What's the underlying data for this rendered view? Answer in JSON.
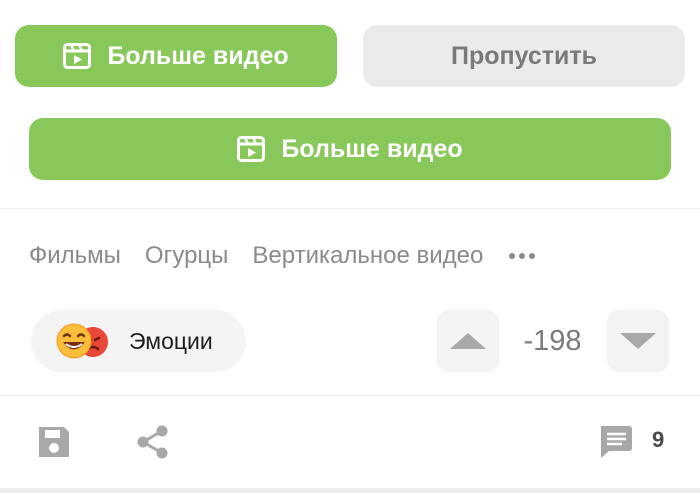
{
  "buttons": {
    "more_video_top": "Больше видео",
    "skip": "Пропустить",
    "more_video_wide": "Больше видео"
  },
  "tags": [
    "Фильмы",
    "Огурцы",
    "Вертикальное видео"
  ],
  "emotions": {
    "label": "Эмоции"
  },
  "rating": {
    "score": "-198"
  },
  "footer": {
    "comments_count": "9"
  },
  "colors": {
    "accent_green": "#88c85a",
    "gray_button": "#ebebeb",
    "icon_gray": "#a8a8a8"
  },
  "icons": [
    "video-icon",
    "more-dots-icon",
    "emoji-laugh-icon",
    "emoji-angry-icon",
    "arrow-up-icon",
    "arrow-down-icon",
    "save-icon",
    "share-icon",
    "comment-icon"
  ]
}
